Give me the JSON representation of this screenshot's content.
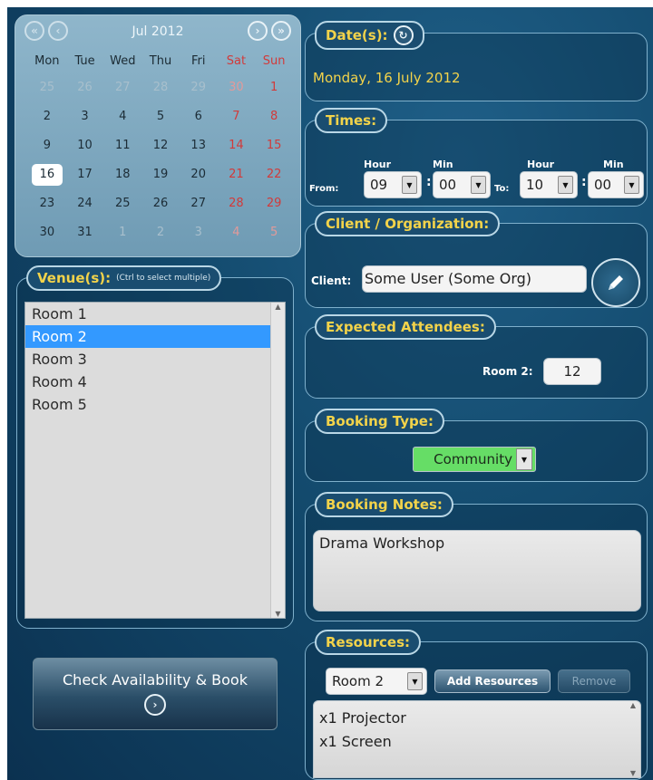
{
  "calendar": {
    "month_label": "Jul 2012",
    "days_of_week": [
      "Mon",
      "Tue",
      "Wed",
      "Thu",
      "Fri",
      "Sat",
      "Sun"
    ],
    "weeks": [
      [
        "25",
        "26",
        "27",
        "28",
        "29",
        "30",
        "1"
      ],
      [
        "2",
        "3",
        "4",
        "5",
        "6",
        "7",
        "8"
      ],
      [
        "9",
        "10",
        "11",
        "12",
        "13",
        "14",
        "15"
      ],
      [
        "16",
        "17",
        "18",
        "19",
        "20",
        "21",
        "22"
      ],
      [
        "23",
        "24",
        "25",
        "26",
        "27",
        "28",
        "29"
      ],
      [
        "30",
        "31",
        "1",
        "2",
        "3",
        "4",
        "5"
      ]
    ],
    "selected_day": "16"
  },
  "venues": {
    "legend": "Venue(s):",
    "hint": "(Ctrl to select multiple)",
    "items": [
      "Room 1",
      "Room 2",
      "Room 3",
      "Room 4",
      "Room 5"
    ],
    "selected": "Room 2"
  },
  "check_button": {
    "label": "Check Availability & Book"
  },
  "date": {
    "legend": "Date(s):",
    "value": "Monday, 16 July 2012"
  },
  "times": {
    "legend": "Times:",
    "from_label": "From:",
    "to_label": "To:",
    "hour_label": "Hour",
    "min_label": "Min",
    "from_hour": "09",
    "from_min": "00",
    "to_hour": "10",
    "to_min": "00"
  },
  "client": {
    "legend": "Client / Organization:",
    "label": "Client:",
    "value": "Some User (Some Org)"
  },
  "attendees": {
    "legend": "Expected Attendees:",
    "room_label": "Room 2:",
    "value": "12"
  },
  "booking_type": {
    "legend": "Booking Type:",
    "value": "Community",
    "color": "#66dd66"
  },
  "notes": {
    "legend": "Booking Notes:",
    "value": "Drama Workshop"
  },
  "resources": {
    "legend": "Resources:",
    "room_value": "Room 2",
    "add_label": "Add Resources",
    "remove_label": "Remove",
    "items": [
      "x1 Projector",
      "x1 Screen"
    ]
  },
  "colors": {
    "accent_yellow": "#f3d34a",
    "selection_blue": "#3399ff",
    "weekend_red": "#d23a3a"
  }
}
